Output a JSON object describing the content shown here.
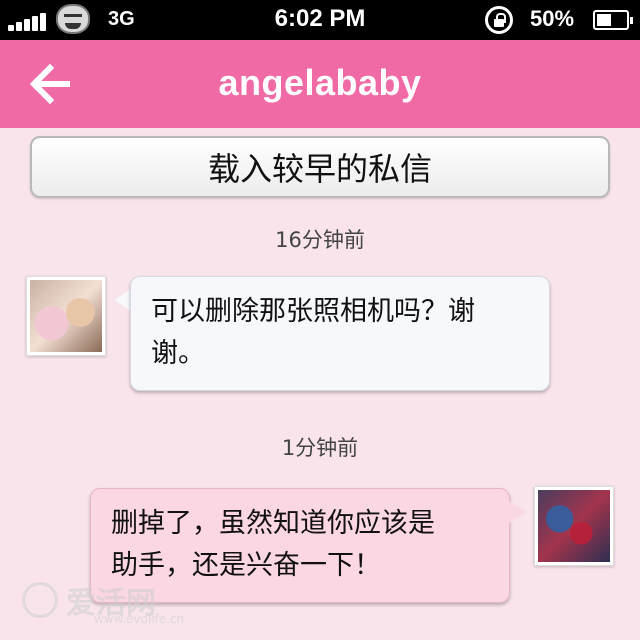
{
  "status_bar": {
    "network": "3G",
    "time": "6:02 PM",
    "battery": "50%",
    "battery_level": 0.5,
    "signal_bars": 5
  },
  "nav": {
    "title": "angelababy",
    "back_icon": "arrow-left-icon"
  },
  "load_earlier_label": "载入较早的私信",
  "messages": [
    {
      "timestamp": "16分钟前",
      "direction": "incoming",
      "text": "可以删除那张照相机吗？谢谢。",
      "line1": "可以删除那张照相机吗？谢",
      "line2": "谢。"
    },
    {
      "timestamp": "1分钟前",
      "direction": "outgoing",
      "text": "删掉了，虽然知道你应该是助手，还是兴奋一下！",
      "line1": "删掉了，虽然知道你应该是",
      "line2": "助手，还是兴奋一下！"
    }
  ],
  "watermark": {
    "name": "爱活网",
    "url": "www.evolife.cn"
  },
  "colors": {
    "nav_background": "#f06aa6",
    "page_background": "#f8e4ea",
    "outgoing_bubble": "#fbd6e3",
    "incoming_bubble": "#f6f8fb"
  }
}
